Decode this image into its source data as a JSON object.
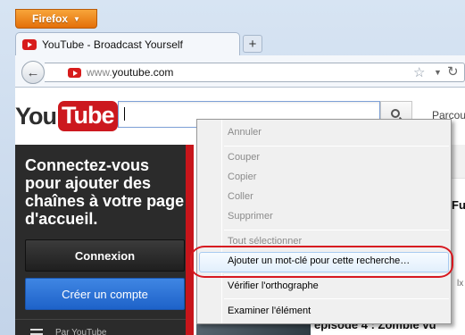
{
  "browser": {
    "menu_button": "Firefox",
    "tab_title": "YouTube - Broadcast Yourself",
    "new_tab": "+",
    "url_prefix": "www.",
    "url_host": "youtube.com"
  },
  "youtube": {
    "logo_you": "You",
    "logo_tube": "Tube",
    "browse_link": "Parcourir",
    "signin_message": "Connectez-vous pour ajouter des chaînes à votre page d'accueil.",
    "signin_button": "Connexion",
    "create_button": "Créer un compte",
    "guide_peek": "Par YouTube",
    "peek_title_right": "Fu",
    "peek_bottom": "épisode 4 : Zombie vu",
    "peek_side": "lx"
  },
  "context_menu": {
    "undo": "Annuler",
    "cut": "Couper",
    "copy": "Copier",
    "paste": "Coller",
    "delete": "Supprimer",
    "select_all": "Tout sélectionner",
    "add_keyword": "Ajouter un mot-clé pour cette recherche…",
    "spellcheck": "Vérifier l'orthographe",
    "inspect": "Examiner l'élément"
  },
  "colors": {
    "firefox_orange": "#e46f09",
    "youtube_red": "#cc181e",
    "create_blue": "#1e62c9",
    "highlight_ring": "#d71920"
  }
}
